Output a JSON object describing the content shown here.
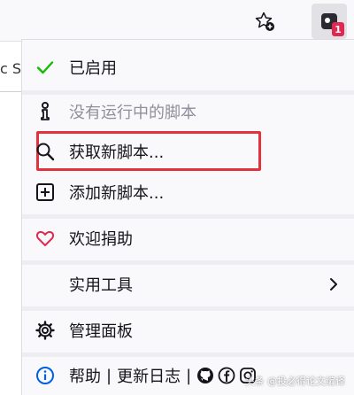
{
  "toolbar": {
    "star_icon": "star-add-icon",
    "extension_icon": "userscript-extension-icon",
    "extension_badge": "1"
  },
  "background_page": {
    "tab_text": "c Sc"
  },
  "menu": {
    "enabled_label": "已启用",
    "no_scripts_label": "没有运行中的脚本",
    "get_scripts_label": "获取新脚本...",
    "add_script_label": "添加新脚本...",
    "donate_label": "欢迎捐助",
    "utilities_label": "实用工具",
    "dashboard_label": "管理面板",
    "help_label": "帮助",
    "separator": "|",
    "changelog_label": "更新日志"
  },
  "colors": {
    "check_green": "#12bc00",
    "heart_red": "#e22850",
    "info_blue": "#0060df",
    "highlight_red": "#e3323b"
  },
  "watermark": "头条 @投必得论文编译"
}
